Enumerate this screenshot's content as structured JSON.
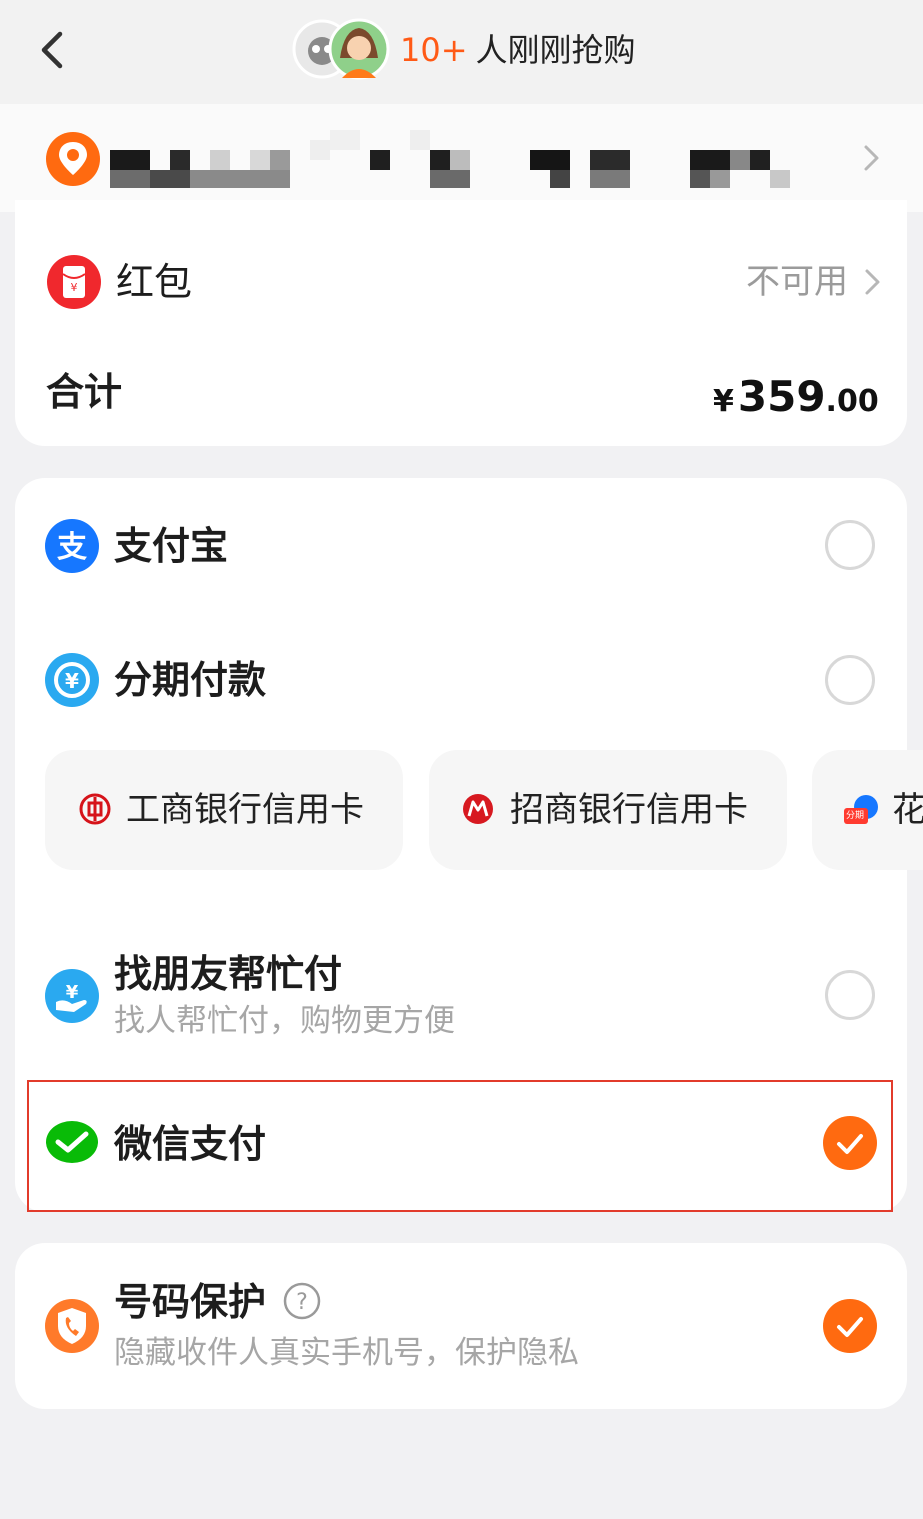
{
  "header": {
    "buyers_count": "10+",
    "buyers_text": "人刚刚抢购"
  },
  "summary": {
    "red_packet_label": "红包",
    "red_packet_status": "不可用",
    "total_label": "合计",
    "total_currency": "¥",
    "total_integer": "359",
    "total_decimal": ".00"
  },
  "payment": {
    "alipay": "支付宝",
    "installment": "分期付款",
    "cards": [
      {
        "label": "工商银行信用卡"
      },
      {
        "label": "招商银行信用卡"
      },
      {
        "label": "花",
        "icon_badge": "分期"
      }
    ],
    "friend_pay": "找朋友帮忙付",
    "friend_pay_sub": "找人帮忙付，购物更方便",
    "wechat": "微信支付",
    "selected": "wechat"
  },
  "privacy": {
    "title": "号码保护",
    "sub": "隐藏收件人真实手机号，保护隐私",
    "enabled": true
  },
  "colors": {
    "accent": "#ff6a10",
    "alipay_blue": "#1677ff",
    "wechat_green": "#09bb07",
    "highlight_red": "#e23b2b"
  }
}
